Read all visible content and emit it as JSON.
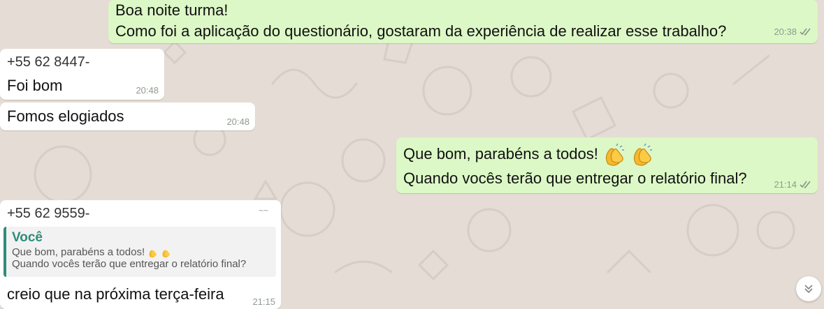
{
  "colors": {
    "outgoing_bubble": "#dcf8c6",
    "incoming_bubble": "#ffffff",
    "wallpaper": "#e5ddd5",
    "quote_accent": "#2f8c7a",
    "tick": "#8a958a"
  },
  "messages": [
    {
      "direction": "outgoing",
      "lines": [
        "Boa noite turma!",
        "Como foi a aplicação do questionário,  gostaram da experiência de realizar esse trabalho?"
      ],
      "time": "20:38",
      "status_icon": "double-check-icon"
    },
    {
      "direction": "incoming",
      "sender": "+55 62 8447-",
      "text": "Foi bom",
      "time": "20:48"
    },
    {
      "direction": "incoming",
      "text": "Fomos elogiados",
      "time": "20:48"
    },
    {
      "direction": "outgoing",
      "lines": [
        "Que bom,  parabéns a todos!",
        "Quando vocês terão que entregar o relatório final?"
      ],
      "emoji": [
        "clapping-hands-icon",
        "clapping-hands-icon"
      ],
      "time": "21:14",
      "status_icon": "double-check-icon"
    },
    {
      "direction": "incoming",
      "sender": "+55 62 9559-",
      "sender_suffix": "~~",
      "quote": {
        "author": "Você",
        "lines": [
          "Que bom,  parabéns a todos!",
          "Quando vocês terão que entregar o relatório final?"
        ]
      },
      "text": "creio que na próxima terça-feira",
      "time": "21:15"
    }
  ],
  "scroll_button_icon": "double-chevron-down-icon"
}
